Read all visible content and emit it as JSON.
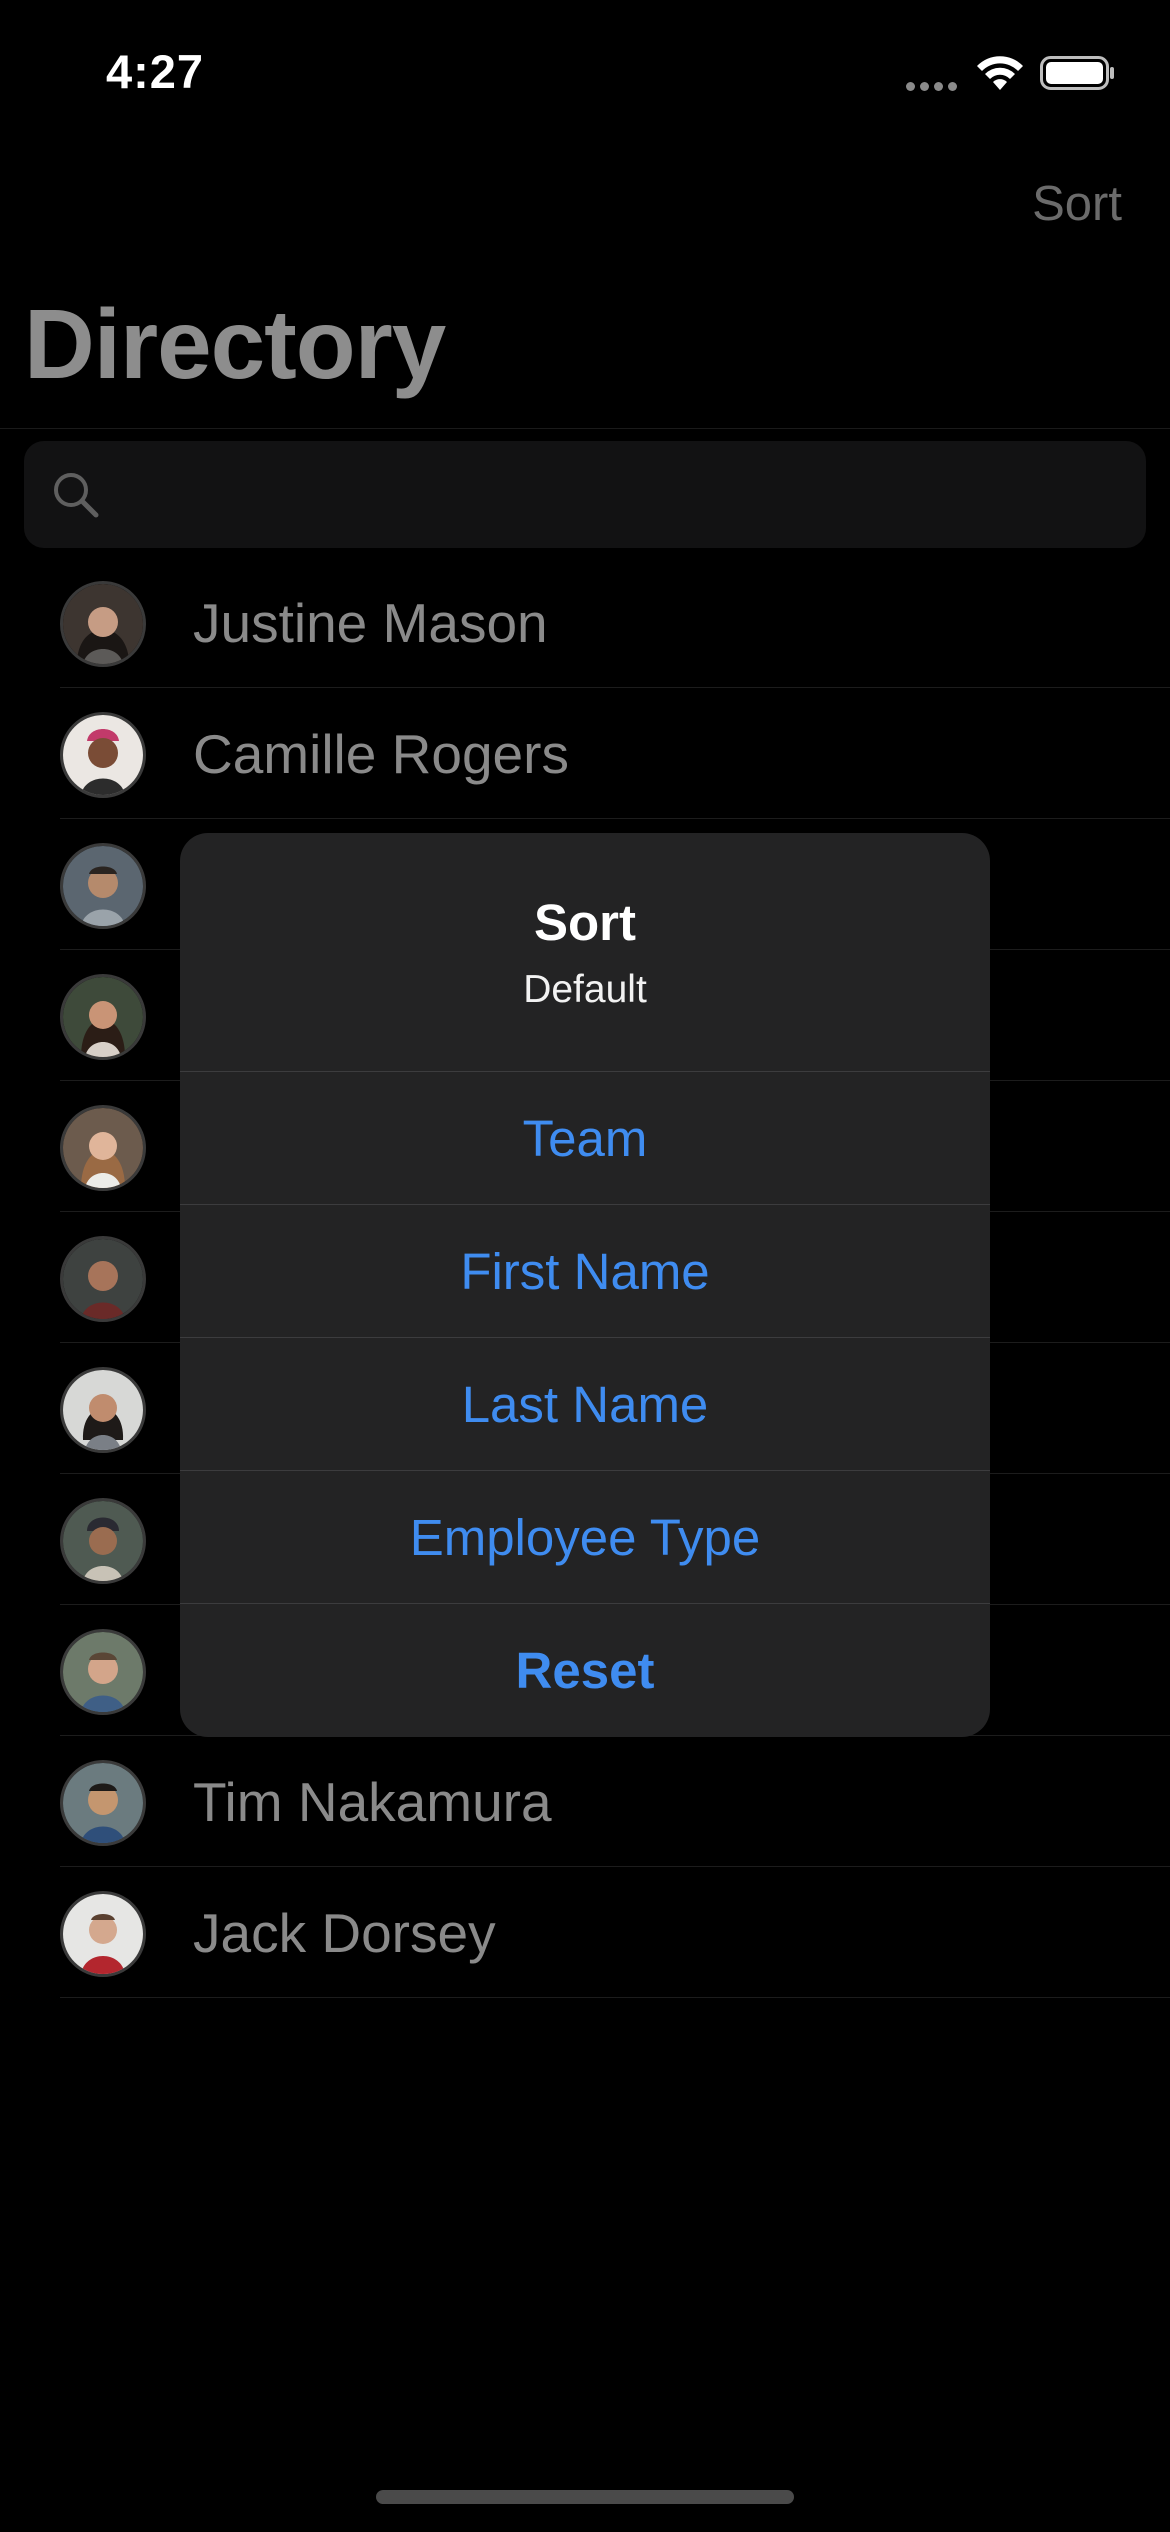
{
  "status_bar": {
    "time": "4:27"
  },
  "nav": {
    "sort_label": "Sort",
    "title": "Directory"
  },
  "search": {
    "placeholder": "",
    "value": ""
  },
  "contacts": [
    {
      "name": "Justine Mason",
      "visible": true
    },
    {
      "name": "Camille Rogers",
      "visible": true
    },
    {
      "name": "",
      "visible": false
    },
    {
      "name": "",
      "visible": false
    },
    {
      "name": "",
      "visible": false
    },
    {
      "name": "",
      "visible": false
    },
    {
      "name": "",
      "visible": false
    },
    {
      "name": "",
      "visible": false
    },
    {
      "name": "",
      "visible": false
    },
    {
      "name": "Tim Nakamura",
      "visible": true
    },
    {
      "name": "Jack Dorsey",
      "visible": true
    }
  ],
  "alert": {
    "title": "Sort",
    "message": "Default",
    "actions": [
      {
        "label": "Team"
      },
      {
        "label": "First Name"
      },
      {
        "label": "Last Name"
      },
      {
        "label": "Employee Type"
      },
      {
        "label": "Reset"
      }
    ]
  },
  "colors": {
    "accent": "#3f8cf0",
    "background": "#000000",
    "alert_background": "#232324"
  },
  "icons": [
    "search-icon",
    "wifi-icon",
    "battery-icon",
    "avatar"
  ]
}
